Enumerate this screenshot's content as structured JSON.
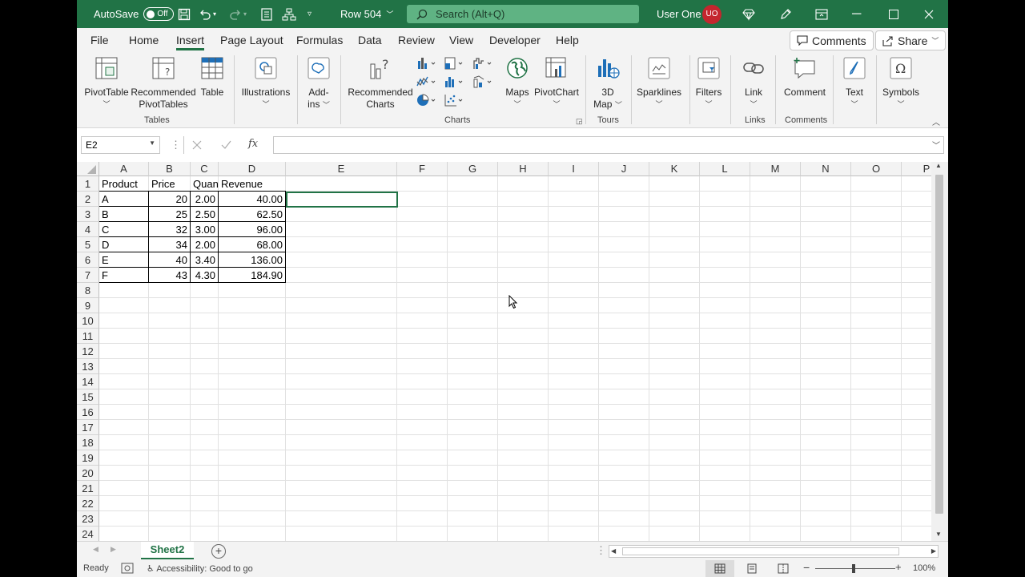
{
  "titlebar": {
    "autosave_label": "AutoSave",
    "autosave_state": "Off",
    "doc_title": "Row 504",
    "search_placeholder": "Search (Alt+Q)",
    "user_name": "User One",
    "user_initials": "UO",
    "accent_color": "#217346"
  },
  "menu": {
    "tabs": [
      "File",
      "Home",
      "Insert",
      "Page Layout",
      "Formulas",
      "Data",
      "Review",
      "View",
      "Developer",
      "Help"
    ],
    "active_tab": "Insert",
    "comments_label": "Comments",
    "share_label": "Share"
  },
  "ribbon": {
    "pivottable": "PivotTable",
    "recommended_pivottables_1": "Recommended",
    "recommended_pivottables_2": "PivotTables",
    "table": "Table",
    "group_tables": "Tables",
    "illustrations": "Illustrations",
    "addins_1": "Add-",
    "addins_2": "ins",
    "recommended_charts_1": "Recommended",
    "recommended_charts_2": "Charts",
    "maps": "Maps",
    "pivotchart": "PivotChart",
    "group_charts": "Charts",
    "map3d_1": "3D",
    "map3d_2": "Map",
    "group_tours": "Tours",
    "sparklines": "Sparklines",
    "filters": "Filters",
    "link": "Link",
    "group_links": "Links",
    "comment": "Comment",
    "group_comments": "Comments",
    "text": "Text",
    "symbols": "Symbols"
  },
  "formula_bar": {
    "name_box": "E2",
    "fx": "fx",
    "content": ""
  },
  "grid": {
    "columns": [
      "A",
      "B",
      "C",
      "D",
      "E",
      "F",
      "G",
      "H",
      "I",
      "J",
      "K",
      "L",
      "M",
      "N",
      "O",
      "P"
    ],
    "rows": [
      "1",
      "2",
      "3",
      "4",
      "5",
      "6",
      "7",
      "8",
      "9",
      "10",
      "11",
      "12",
      "13",
      "14",
      "15",
      "16",
      "17",
      "18",
      "19",
      "20",
      "21",
      "22",
      "23",
      "24"
    ],
    "header": [
      "Product",
      "Price",
      "Quan",
      "Revenue"
    ],
    "data": [
      [
        "A",
        "20",
        "2.00",
        "40.00"
      ],
      [
        "B",
        "25",
        "2.50",
        "62.50"
      ],
      [
        "C",
        "32",
        "3.00",
        "96.00"
      ],
      [
        "D",
        "34",
        "2.00",
        "68.00"
      ],
      [
        "E",
        "40",
        "3.40",
        "136.00"
      ],
      [
        "F",
        "43",
        "4.30",
        "184.90"
      ]
    ]
  },
  "sheets": {
    "active": "Sheet2"
  },
  "status": {
    "ready": "Ready",
    "accessibility": "Accessibility: Good to go",
    "zoom": "100%"
  }
}
